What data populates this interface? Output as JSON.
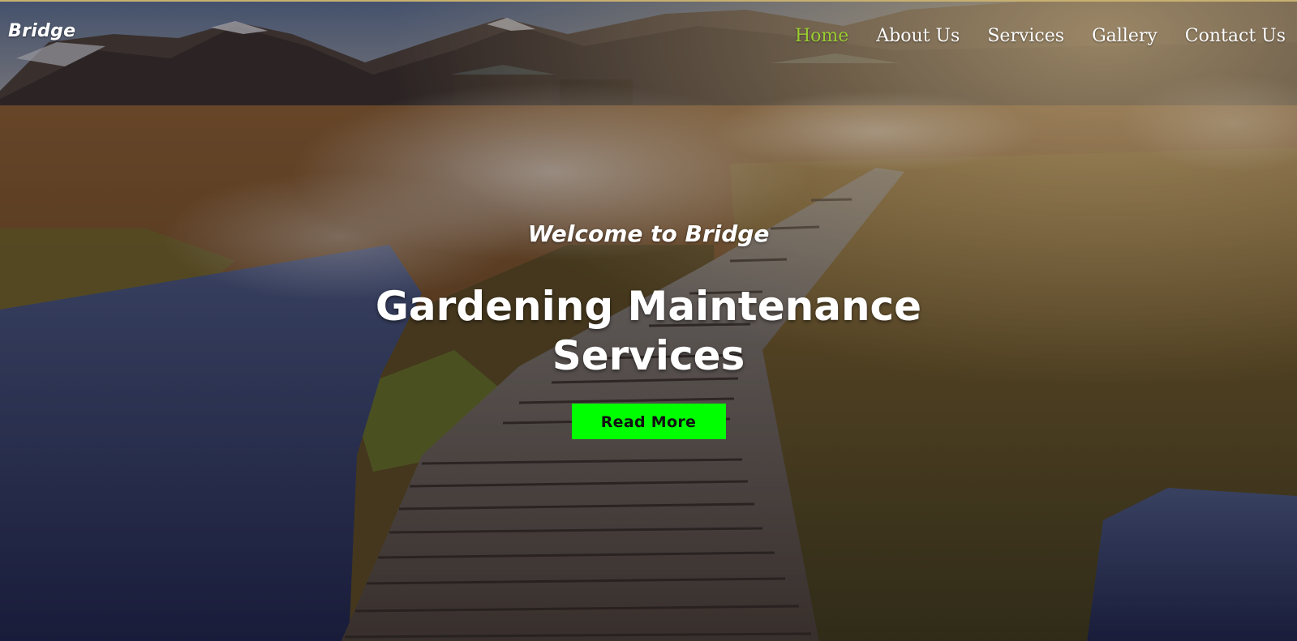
{
  "brand": {
    "logo_text": "Bridge"
  },
  "nav": {
    "items": [
      {
        "label": "Home",
        "active": true
      },
      {
        "label": "About Us",
        "active": false
      },
      {
        "label": "Services",
        "active": false
      },
      {
        "label": "Gallery",
        "active": false
      },
      {
        "label": "Contact Us",
        "active": false
      }
    ]
  },
  "hero": {
    "welcome": "Welcome to Bridge",
    "headline_line1": "Gardening Maintenance",
    "headline_line2": "Services",
    "cta_label": "Read More",
    "background_image": "landscape-boardwalk-photo"
  },
  "colors": {
    "nav_active": "#9acd32",
    "nav_text": "#ffffff",
    "cta_bg": "#00ff00",
    "cta_text": "#111111"
  }
}
